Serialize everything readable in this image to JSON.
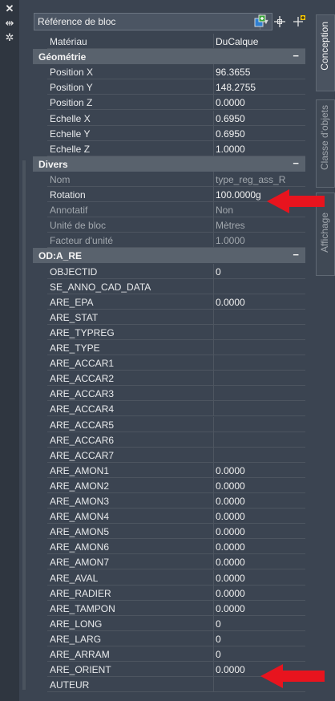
{
  "window": {
    "close_icon": "close-icon",
    "pin_icon": "pin-icon",
    "settings_icon": "gear-icon"
  },
  "toolbar": {
    "object_type": "Référence de bloc",
    "buttons": [
      "quick-select-icon",
      "select-objects-icon",
      "toggle-pickadd-icon"
    ]
  },
  "tabs": [
    "Conception",
    "Classe d'objets",
    "Affichage"
  ],
  "top_property": {
    "name": "Matériau",
    "value": "DuCalque"
  },
  "categories": [
    {
      "label": "Géométrie",
      "toggle": "−",
      "rows": [
        {
          "name": "Position X",
          "value": "96.3655"
        },
        {
          "name": "Position Y",
          "value": "148.2755"
        },
        {
          "name": "Position Z",
          "value": "0.0000"
        },
        {
          "name": "Echelle X",
          "value": "0.6950"
        },
        {
          "name": "Echelle Y",
          "value": "0.6950"
        },
        {
          "name": "Echelle Z",
          "value": "1.0000"
        }
      ]
    },
    {
      "label": "Divers",
      "toggle": "−",
      "rows": [
        {
          "name": "Nom",
          "value": "type_reg_ass_R",
          "dim": true
        },
        {
          "name": "Rotation",
          "value": "100.0000g",
          "dim": false
        },
        {
          "name": "Annotatif",
          "value": "Non",
          "dim": true
        },
        {
          "name": "Unité de bloc",
          "value": "Mètres",
          "dim": true
        },
        {
          "name": "Facteur d'unité",
          "value": "1.0000",
          "dim": true
        }
      ]
    },
    {
      "label": "OD:A_RE",
      "toggle": "−",
      "rows": [
        {
          "name": "OBJECTID",
          "value": "0"
        },
        {
          "name": "SE_ANNO_CAD_DATA",
          "value": ""
        },
        {
          "name": "ARE_EPA",
          "value": "0.0000"
        },
        {
          "name": "ARE_STAT",
          "value": ""
        },
        {
          "name": "ARE_TYPREG",
          "value": ""
        },
        {
          "name": "ARE_TYPE",
          "value": ""
        },
        {
          "name": "ARE_ACCAR1",
          "value": ""
        },
        {
          "name": "ARE_ACCAR2",
          "value": ""
        },
        {
          "name": "ARE_ACCAR3",
          "value": ""
        },
        {
          "name": "ARE_ACCAR4",
          "value": ""
        },
        {
          "name": "ARE_ACCAR5",
          "value": ""
        },
        {
          "name": "ARE_ACCAR6",
          "value": ""
        },
        {
          "name": "ARE_ACCAR7",
          "value": ""
        },
        {
          "name": "ARE_AMON1",
          "value": "0.0000"
        },
        {
          "name": "ARE_AMON2",
          "value": "0.0000"
        },
        {
          "name": "ARE_AMON3",
          "value": "0.0000"
        },
        {
          "name": "ARE_AMON4",
          "value": "0.0000"
        },
        {
          "name": "ARE_AMON5",
          "value": "0.0000"
        },
        {
          "name": "ARE_AMON6",
          "value": "0.0000"
        },
        {
          "name": "ARE_AMON7",
          "value": "0.0000"
        },
        {
          "name": "ARE_AVAL",
          "value": "0.0000"
        },
        {
          "name": "ARE_RADIER",
          "value": "0.0000"
        },
        {
          "name": "ARE_TAMPON",
          "value": "0.0000"
        },
        {
          "name": "ARE_LONG",
          "value": "0"
        },
        {
          "name": "ARE_LARG",
          "value": "0"
        },
        {
          "name": "ARE_ARRAM",
          "value": "0"
        },
        {
          "name": "ARE_ORIENT",
          "value": "0.0000"
        },
        {
          "name": "AUTEUR",
          "value": ""
        }
      ]
    }
  ],
  "annotations": {
    "arrow_color": "#e8141e"
  },
  "colors": {
    "background": "#3b4451",
    "category_header": "#59626d"
  }
}
